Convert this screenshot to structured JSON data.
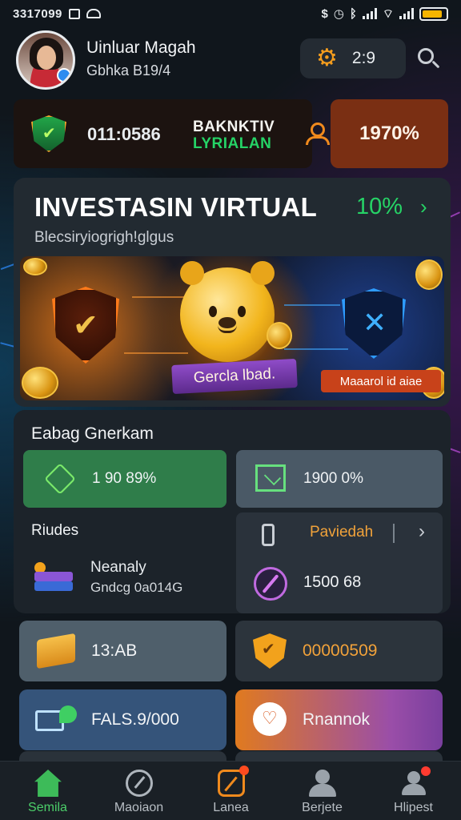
{
  "status_bar": {
    "time": "3317099",
    "battery_level": 0.85,
    "accent_color": "#f5b400"
  },
  "header": {
    "user_name": "Uinluar Magah",
    "user_sub": "Gbhka B19/4",
    "pill_icon": "gear-icon",
    "pill_value": "2:9"
  },
  "top_strip": {
    "value": "011:0586",
    "brand_top": "BAKNKTIV",
    "brand_bottom": "LYRIALAN",
    "percent": "1970%"
  },
  "hero": {
    "title": "INVESTASIN VIRTUAL",
    "percent": "10%",
    "subtitle": "Blecsiryiogrigh!glgus",
    "ribbon_label": "Gercla lbad.",
    "tag_label": "Maaarol id aiae",
    "accent_color": "#26d366"
  },
  "section": {
    "title": "Eabag Gnerkam",
    "tile_green": "1 90 89%",
    "tile_steel": "1900 0%",
    "label": "Riudes",
    "nearby_title": "Neanaly",
    "nearby_sub": "Gndcg 0a014G",
    "pay_label": "Paviedah",
    "pay_value": "1500 68"
  },
  "tiles": {
    "a": "13:AB",
    "b": "00000509",
    "c": "FALS.9/000",
    "d": "Rnannok"
  },
  "nav": {
    "items": [
      {
        "label": "Semila",
        "icon": "home-icon",
        "active": true
      },
      {
        "label": "Maoiaon",
        "icon": "gauge-icon",
        "active": false
      },
      {
        "label": "Lanea",
        "icon": "shop-icon",
        "active": false
      },
      {
        "label": "Berjete",
        "icon": "people-icon",
        "active": false
      },
      {
        "label": "Hlipest",
        "icon": "person-icon",
        "active": false
      }
    ],
    "active_color": "#4ccf6a"
  }
}
